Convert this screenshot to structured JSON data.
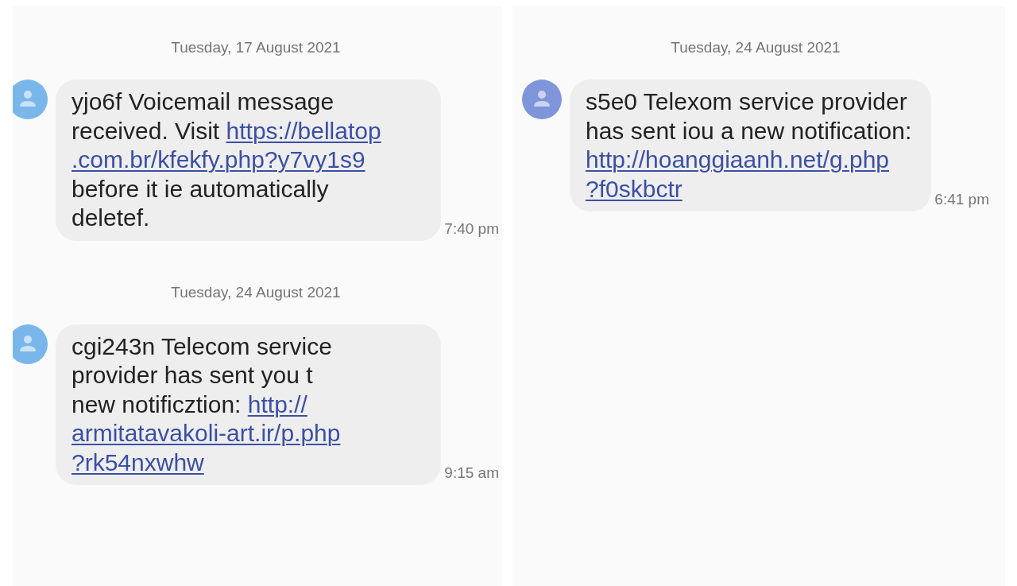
{
  "panels": [
    {
      "messages": [
        {
          "date": "Tuesday, 17 August 2021",
          "color": "#79b7eb",
          "time": "7:40 pm",
          "lines": [
            [
              {
                "kind": "text",
                "text": "yjo6f Voicemail message"
              }
            ],
            [
              {
                "kind": "text",
                "text": "received. Visit "
              },
              {
                "kind": "link",
                "text": "https://bellatop"
              }
            ],
            [
              {
                "kind": "link",
                "text": ".com.br/kfekfy.php?y7vy1s9"
              }
            ],
            [
              {
                "kind": "text",
                "text": "before it ie automatically"
              }
            ],
            [
              {
                "kind": "text",
                "text": "deletef."
              }
            ]
          ]
        },
        {
          "date": "Tuesday, 24 August 2021",
          "color": "#79b7eb",
          "time": "9:15 am",
          "lines": [
            [
              {
                "kind": "text",
                "text": "cgi243n Telecom service"
              }
            ],
            [
              {
                "kind": "text",
                "text": "provider has sent you t"
              }
            ],
            [
              {
                "kind": "text",
                "text": "new notificztion: "
              },
              {
                "kind": "link",
                "text": "http://"
              }
            ],
            [
              {
                "kind": "link",
                "text": "armitatavakoli-art.ir/p.php"
              }
            ],
            [
              {
                "kind": "link",
                "text": "?rk54nxwhw"
              }
            ]
          ]
        }
      ]
    },
    {
      "messages": [
        {
          "date": "Tuesday, 24 August 2021",
          "color": "#7f95da",
          "time": "6:41 pm",
          "lines": [
            [
              {
                "kind": "text",
                "text": "s5e0 Telexom service provider"
              }
            ],
            [
              {
                "kind": "text",
                "text": "has sent iou a new notification:"
              }
            ],
            [
              {
                "kind": "link",
                "text": "http://hoanggiaanh.net/g.php"
              }
            ],
            [
              {
                "kind": "link",
                "text": "?f0skbctr"
              }
            ]
          ]
        }
      ]
    }
  ]
}
